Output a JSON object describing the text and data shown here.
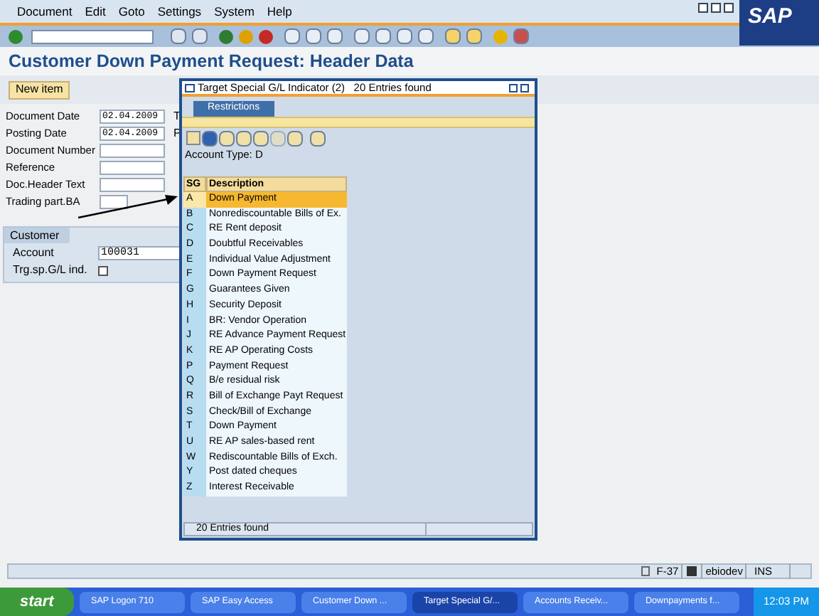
{
  "menu": [
    {
      "label": "Document"
    },
    {
      "label": "Edit"
    },
    {
      "label": "Goto"
    },
    {
      "label": "Settings"
    },
    {
      "label": "System"
    },
    {
      "label": "Help"
    }
  ],
  "logo": "SAP",
  "title": "Customer Down Payment Request: Header Data",
  "app_toolbar": {
    "button": "New item"
  },
  "header_fields": [
    {
      "label": "Document Date",
      "value": "02.04.2009",
      "side_label": "T"
    },
    {
      "label": "Posting Date",
      "value": "02.04.2009",
      "side_label": "P"
    },
    {
      "label": "Document Number"
    },
    {
      "label": "Reference"
    },
    {
      "label": "Doc.Header Text"
    },
    {
      "label": "Trading part.BA"
    }
  ],
  "customer_group": {
    "title": "Customer",
    "account_label": "Account",
    "account_value": "100031",
    "indicator_label": "Trg.sp.G/L ind."
  },
  "dialog": {
    "title": "Target Special G/L Indicator (2)   20 Entries found",
    "tab": {
      "label": "Restrictions",
      "selected": true
    },
    "account_type": "Account Type: D",
    "columns": [
      "SG",
      "Description"
    ],
    "rows": [
      {
        "code": "A",
        "description": "Down Payment",
        "selected": true
      },
      {
        "code": "B",
        "description": "Nonrediscountable Bills of Ex.",
        "selected": false
      },
      {
        "code": "C",
        "description": "RE Rent deposit",
        "selected": false
      },
      {
        "code": "D",
        "description": "Doubtful Receivables",
        "selected": false
      },
      {
        "code": "E",
        "description": "Individual Value Adjustment",
        "selected": false
      },
      {
        "code": "F",
        "description": "Down Payment Request",
        "selected": false
      },
      {
        "code": "G",
        "description": "Guarantees Given",
        "selected": false
      },
      {
        "code": "H",
        "description": "Security Deposit",
        "selected": false
      },
      {
        "code": "I",
        "description": "BR: Vendor Operation",
        "selected": false
      },
      {
        "code": "J",
        "description": "RE Advance Payment Request",
        "selected": false
      },
      {
        "code": "K",
        "description": "RE AP Operating Costs",
        "selected": false
      },
      {
        "code": "P",
        "description": "Payment Request",
        "selected": false
      },
      {
        "code": "Q",
        "description": "B/e residual risk",
        "selected": false
      },
      {
        "code": "R",
        "description": "Bill of Exchange Payt Request",
        "selected": false
      },
      {
        "code": "S",
        "description": "Check/Bill of Exchange",
        "selected": false
      },
      {
        "code": "T",
        "description": "Down Payment",
        "selected": false
      },
      {
        "code": "U",
        "description": "RE AP sales-based rent",
        "selected": false
      },
      {
        "code": "W",
        "description": "Rediscountable Bills of Exch.",
        "selected": false
      },
      {
        "code": "Y",
        "description": "Post dated cheques",
        "selected": false
      },
      {
        "code": "Z",
        "description": "Interest Receivable",
        "selected": false
      }
    ],
    "status": "20 Entries found"
  },
  "status_bar": {
    "transaction": "F-37",
    "user": "ebiodev",
    "mode": "INS"
  },
  "taskbar": {
    "start": "start",
    "items": [
      {
        "label": "SAP Logon 710",
        "selected": false
      },
      {
        "label": "SAP Easy Access",
        "selected": false
      },
      {
        "label": "Customer Down ...",
        "selected": false
      },
      {
        "label": "Target Special G/...",
        "selected": true
      },
      {
        "label": "Accounts Receiv...",
        "selected": false
      },
      {
        "label": "Downpayments f...",
        "selected": false
      }
    ],
    "clock": "12:03 PM"
  }
}
